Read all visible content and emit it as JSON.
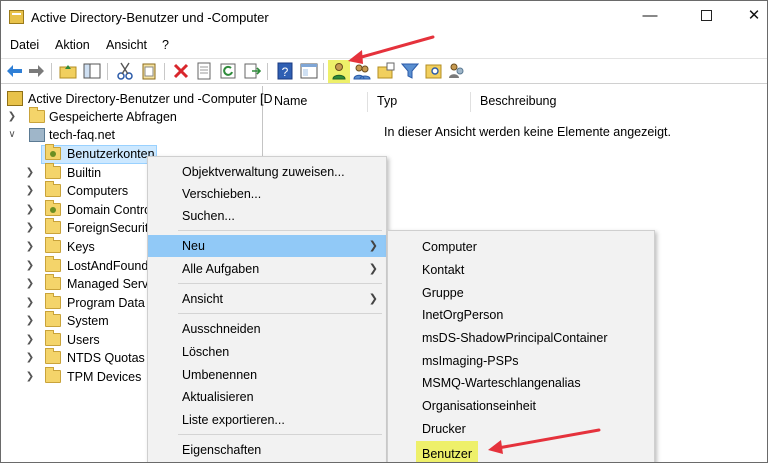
{
  "window": {
    "title": "Active Directory-Benutzer und -Computer",
    "min_glyph": "—",
    "close_glyph": "✕"
  },
  "menubar": [
    "Datei",
    "Aktion",
    "Ansicht",
    "?"
  ],
  "toolbar": {
    "icons": [
      "back-arrow-icon",
      "forward-arrow-icon",
      "up-folder-icon",
      "show-hide-tree-icon",
      "cut-icon",
      "copy-icon",
      "delete-icon",
      "properties-icon",
      "refresh-icon",
      "export-list-icon",
      "help-icon",
      "console-icon",
      "new-user-icon",
      "new-group-icon",
      "new-ou-icon",
      "filter-icon",
      "find-icon",
      "add-to-group-icon"
    ],
    "highlighted": "new-user-icon"
  },
  "tree": {
    "root": "Active Directory-Benutzer und -Computer [D",
    "saved_queries": "Gespeicherte Abfragen",
    "domain": "tech-faq.net",
    "children": [
      "Benutzerkonten",
      "Builtin",
      "Computers",
      "Domain Contro",
      "ForeignSecurity",
      "Keys",
      "LostAndFound",
      "Managed Servi",
      "Program Data",
      "System",
      "Users",
      "NTDS Quotas",
      "TPM Devices"
    ]
  },
  "list": {
    "columns": [
      "Name",
      "Typ",
      "Beschreibung"
    ],
    "empty_message": "In dieser Ansicht werden keine Elemente angezeigt."
  },
  "context_menu": {
    "items": [
      "Objektverwaltung zuweisen...",
      "Verschieben...",
      "Suchen...",
      "Neu",
      "Alle Aufgaben",
      "Ansicht",
      "Ausschneiden",
      "Löschen",
      "Umbenennen",
      "Aktualisieren",
      "Liste exportieren...",
      "Eigenschaften"
    ],
    "active": "Neu"
  },
  "submenu_new": {
    "items": [
      "Computer",
      "Kontakt",
      "Gruppe",
      "InetOrgPerson",
      "msDS-ShadowPrincipalContainer",
      "msImaging-PSPs",
      "MSMQ-Warteschlangenalias",
      "Organisationseinheit",
      "Drucker",
      "Benutzer"
    ],
    "highlighted": "Benutzer"
  },
  "colors": {
    "selection": "#cce8ff",
    "menu_active": "#91c9f7",
    "highlight": "#eef06a",
    "annotation_arrow": "#e5323c"
  }
}
